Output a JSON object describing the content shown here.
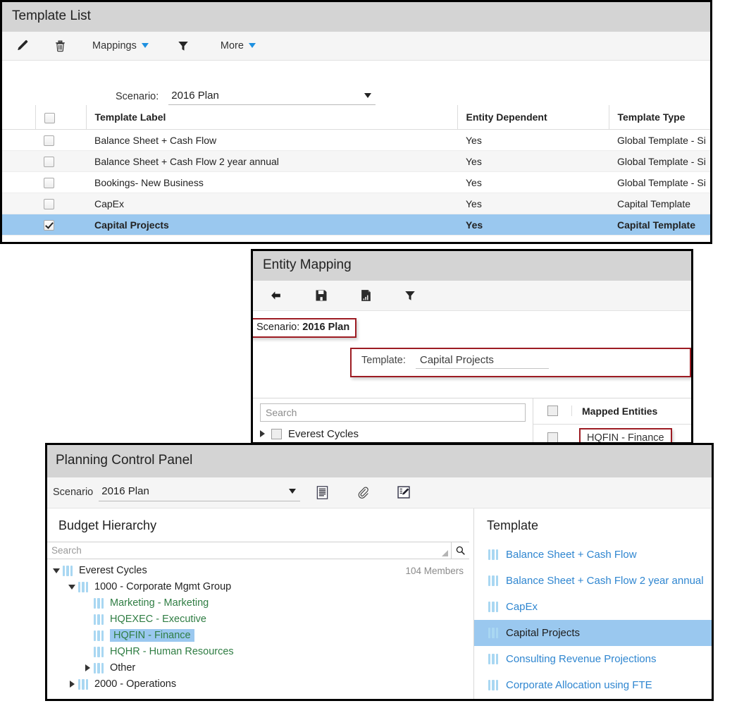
{
  "template_list": {
    "title": "Template List",
    "toolbar": {
      "edit_icon": "pencil-icon",
      "delete_icon": "trash-icon",
      "mappings_label": "Mappings",
      "filter_icon": "funnel-icon",
      "more_label": "More"
    },
    "scenario": {
      "label": "Scenario:",
      "value": "2016 Plan"
    },
    "columns": [
      "",
      "",
      "Template Label",
      "Entity Dependent",
      "Template Type"
    ],
    "rows": [
      {
        "label": "Balance Sheet + Cash Flow",
        "entity_dependent": "Yes",
        "template_type": "Global Template - Si",
        "checked": false,
        "selected": false
      },
      {
        "label": "Balance Sheet + Cash Flow 2 year annual",
        "entity_dependent": "Yes",
        "template_type": "Global Template - Si",
        "checked": false,
        "selected": false
      },
      {
        "label": "Bookings- New Business",
        "entity_dependent": "Yes",
        "template_type": "Global Template - Si",
        "checked": false,
        "selected": false
      },
      {
        "label": "CapEx",
        "entity_dependent": "Yes",
        "template_type": "Capital Template",
        "checked": false,
        "selected": false
      },
      {
        "label": "Capital Projects",
        "entity_dependent": "Yes",
        "template_type": "Capital Template",
        "checked": true,
        "selected": true
      }
    ]
  },
  "entity_mapping": {
    "title": "Entity Mapping",
    "toolbar": {
      "back_icon": "back-arrow-icon",
      "save_icon": "save-disk-icon",
      "report_icon": "report-document-icon",
      "filter_icon": "funnel-icon"
    },
    "scenario_text": "Scenario: ",
    "scenario_value": "2016 Plan",
    "template_label": "Template:",
    "template_value": "Capital Projects",
    "search_placeholder": "Search",
    "tree_root": "Everest Cycles",
    "mapped_header": "Mapped Entities",
    "mapped_rows": [
      "HQFIN - Finance"
    ]
  },
  "planning_control_panel": {
    "title": "Planning Control Panel",
    "scenario_label": "Scenario",
    "scenario_value": "2016 Plan",
    "toolbar_icons": [
      "notes-document-icon",
      "paperclip-icon",
      "edit-form-icon"
    ],
    "budget_hierarchy_title": "Budget Hierarchy",
    "search_placeholder": "Search",
    "members_count": "104 Members",
    "tree": [
      {
        "label": "Everest Cycles",
        "depth": 0,
        "expander": "down",
        "style": "plain",
        "selected": false
      },
      {
        "label": "1000 - Corporate Mgmt Group",
        "depth": 1,
        "expander": "down",
        "style": "plain",
        "selected": false
      },
      {
        "label": "Marketing - Marketing",
        "depth": 2,
        "expander": "none",
        "style": "green",
        "selected": false
      },
      {
        "label": "HQEXEC - Executive",
        "depth": 2,
        "expander": "none",
        "style": "green",
        "selected": false
      },
      {
        "label": "HQFIN - Finance",
        "depth": 2,
        "expander": "none",
        "style": "green",
        "selected": true
      },
      {
        "label": "HQHR - Human Resources",
        "depth": 2,
        "expander": "none",
        "style": "green",
        "selected": false
      },
      {
        "label": "Other",
        "depth": 1.6,
        "expander": "right",
        "style": "plain",
        "selected": false
      },
      {
        "label": "2000 - Operations",
        "depth": 0.9,
        "expander": "right",
        "style": "plain",
        "selected": false
      }
    ],
    "template_title": "Template",
    "templates": [
      {
        "label": "Balance Sheet + Cash Flow",
        "selected": false
      },
      {
        "label": "Balance Sheet + Cash Flow 2 year annual",
        "selected": false
      },
      {
        "label": "CapEx",
        "selected": false
      },
      {
        "label": "Capital Projects",
        "selected": true
      },
      {
        "label": "Consulting Revenue Projections",
        "selected": false
      },
      {
        "label": "Corporate Allocation using FTE",
        "selected": false
      }
    ]
  },
  "colors": {
    "selection_blue": "#9ac8ef",
    "header_gray": "#d4d4d4",
    "link_blue": "#2f86d0",
    "tree_green": "#2f7d43",
    "highlight_red": "#9d1c23",
    "bar_icon_blue": "#a9d7f2"
  }
}
